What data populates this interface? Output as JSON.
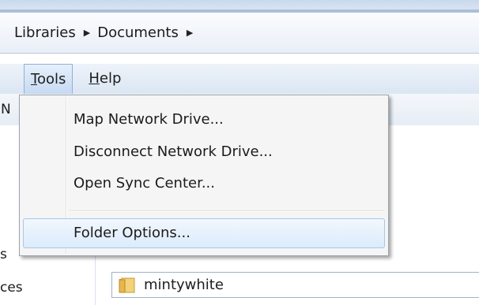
{
  "address": {
    "crumbs": [
      "Libraries",
      "Documents"
    ]
  },
  "menu": {
    "tools_accel": "T",
    "tools_rest": "ools",
    "help_accel": "H",
    "help_rest": "elp"
  },
  "dropdown": {
    "items": [
      "Map Network Drive...",
      "Disconnect Network Drive...",
      "Open Sync Center...",
      "Folder Options..."
    ],
    "highlighted": "Folder Options..."
  },
  "toolbar": {
    "partial_label": "N"
  },
  "sidebar": {
    "partial_1": "s",
    "partial_2": "ces"
  },
  "files": [
    {
      "name": "mintywhite",
      "icon": "folder-icon"
    }
  ],
  "colors": {
    "menu_highlight": "#c6daf2",
    "item_highlight_border": "#a8c7ea",
    "folder": "#e8b84a"
  }
}
